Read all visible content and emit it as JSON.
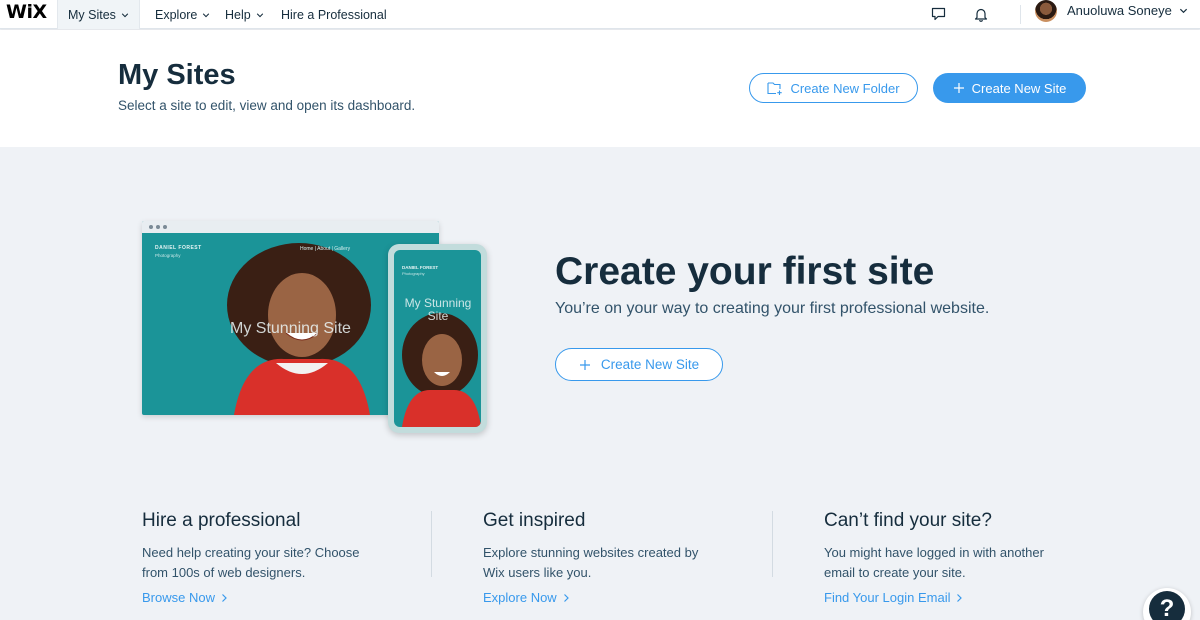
{
  "topbar": {
    "logo": "WiX",
    "nav": [
      "My Sites",
      "Explore",
      "Help",
      "Hire a Professional"
    ],
    "user_name": "Anuoluwa Soneye"
  },
  "header": {
    "title": "My Sites",
    "subtitle": "Select a site to edit, view and open its dashboard.",
    "create_folder_label": "Create New Folder",
    "create_site_label": "Create New Site"
  },
  "hero": {
    "mock_brand": "DANIEL FOREST",
    "mock_brand_sub": "Photography",
    "mock_menu": "Home  |  About  |  Gallery",
    "mock_headline": "My Stunning Site",
    "title": "Create your first site",
    "subtitle": "You’re on your way to creating your first professional website.",
    "button_label": "Create New Site"
  },
  "columns": [
    {
      "title": "Hire a professional",
      "text": "Need help creating your site? Choose from 100s of web designers.",
      "link": "Browse Now"
    },
    {
      "title": "Get inspired",
      "text": "Explore stunning websites created by Wix users like you.",
      "link": "Explore Now"
    },
    {
      "title": "Can’t find your site?",
      "text": "You might have logged in with another email to create your site.",
      "link": "Find Your Login Email"
    }
  ],
  "help": {
    "label": "?"
  },
  "colors": {
    "accent": "#3899ec",
    "text": "#162d3d",
    "background": "#eff2f6",
    "mock_teal": "#1b9498"
  },
  "icons": [
    "chevron-down-icon",
    "chat-icon",
    "bell-icon",
    "folder-plus-icon",
    "plus-icon",
    "chevron-right-icon",
    "help-icon"
  ]
}
